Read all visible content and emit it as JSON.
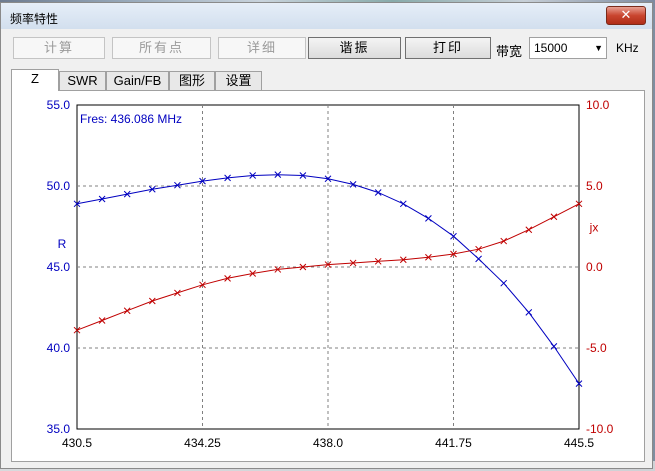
{
  "window": {
    "title": "频率特性",
    "close_glyph": "✕"
  },
  "toolbar": {
    "buttons": [
      {
        "label": "计算",
        "state": "disabled"
      },
      {
        "label": "所有点",
        "state": "disabled"
      },
      {
        "label": "详细",
        "state": "disabled"
      },
      {
        "label": "谐振",
        "state": "enabled"
      },
      {
        "label": "打印",
        "state": "enabled"
      }
    ],
    "bandwidth_label": "带宽",
    "bandwidth_value": "15000",
    "unit": "KHz"
  },
  "tabs": [
    {
      "label": "Z",
      "selected": true
    },
    {
      "label": "SWR",
      "selected": false
    },
    {
      "label": "Gain/FB",
      "selected": false
    },
    {
      "label": "图形",
      "selected": false
    },
    {
      "label": "设置",
      "selected": false
    }
  ],
  "chart_data": {
    "type": "line",
    "annotation": "Fres: 436.086 MHz",
    "ylabel_left": "R",
    "ylabel_right": "jx",
    "grid": true,
    "xlim": [
      430.5,
      445.5
    ],
    "x_ticks": [
      "430.5",
      "434.25",
      "438.0",
      "441.75",
      "445.5"
    ],
    "x_tick_values": [
      430.5,
      434.25,
      438.0,
      441.75,
      445.5
    ],
    "ylim_left": [
      35.0,
      55.0
    ],
    "y_ticks_left": [
      "55.0",
      "50.0",
      "45.0",
      "40.0",
      "35.0"
    ],
    "y_tick_values_left": [
      55,
      50,
      45,
      40,
      35
    ],
    "ylim_right": [
      -10.0,
      10.0
    ],
    "y_ticks_right": [
      "10.0",
      "5.0",
      "0.0",
      "-5.0",
      "-10.0"
    ],
    "y_tick_values_right": [
      10,
      5,
      0,
      -5,
      -10
    ],
    "colors": {
      "left_axis": "#0000c0",
      "right_axis": "#c00000",
      "grid": "#808080",
      "annotation": "#0000c0"
    },
    "series": [
      {
        "axis": "left",
        "color": "#0000c0",
        "x": [
          430.5,
          431.25,
          432.0,
          432.75,
          433.5,
          434.25,
          435.0,
          435.75,
          436.5,
          437.25,
          438.0,
          438.75,
          439.5,
          440.25,
          441.0,
          441.75,
          442.5,
          443.25,
          444.0,
          444.75,
          445.5
        ],
        "y": [
          48.9,
          49.2,
          49.5,
          49.8,
          50.05,
          50.3,
          50.5,
          50.65,
          50.7,
          50.65,
          50.45,
          50.1,
          49.6,
          48.9,
          48.0,
          46.9,
          45.5,
          44.0,
          42.2,
          40.1,
          37.8
        ]
      },
      {
        "axis": "right",
        "color": "#c00000",
        "x": [
          430.5,
          431.25,
          432.0,
          432.75,
          433.5,
          434.25,
          435.0,
          435.75,
          436.5,
          437.25,
          438.0,
          438.75,
          439.5,
          440.25,
          441.0,
          441.75,
          442.5,
          443.25,
          444.0,
          444.75,
          445.5
        ],
        "y": [
          -3.9,
          -3.3,
          -2.7,
          -2.1,
          -1.6,
          -1.1,
          -0.7,
          -0.4,
          -0.15,
          0.0,
          0.15,
          0.25,
          0.35,
          0.45,
          0.6,
          0.8,
          1.1,
          1.6,
          2.3,
          3.1,
          3.9
        ]
      }
    ]
  }
}
